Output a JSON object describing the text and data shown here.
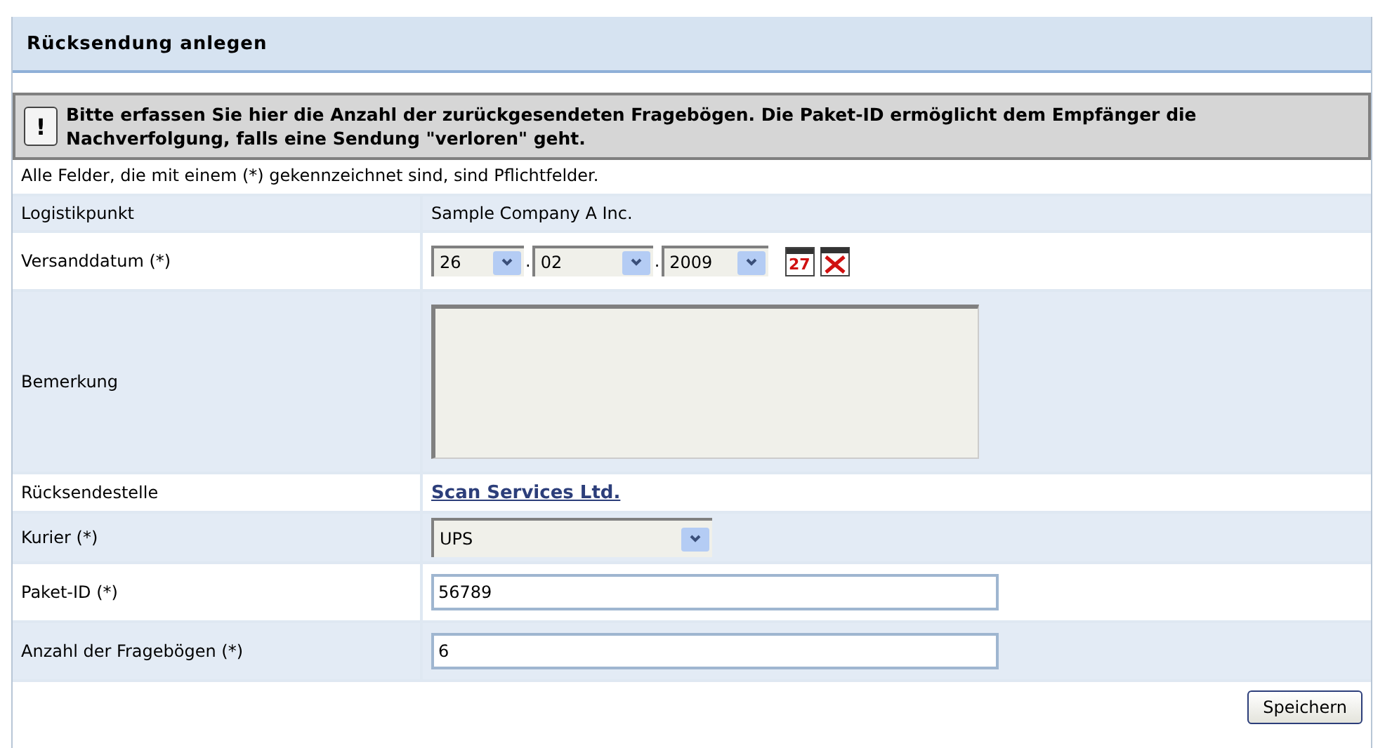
{
  "panel": {
    "title": "Rücksendung anlegen"
  },
  "notice": {
    "icon": "!",
    "text": "Bitte erfassen Sie hier die Anzahl der zurückgesendeten Fragebögen. Die Paket-ID ermöglicht dem Empfänger die Nachverfolgung, falls eine Sendung \"verloren\" geht."
  },
  "hint": "Alle Felder, die mit einem (*) gekennzeichnet sind, sind Pflichtfelder.",
  "rows": [
    {
      "kind": "text",
      "label": "Logistikpunkt",
      "value": "Sample Company A Inc."
    },
    {
      "kind": "date",
      "label": "Versanddatum (*)",
      "day": "26",
      "month": "02",
      "year": "2009",
      "separator": ".",
      "calendar": "27"
    },
    {
      "kind": "textarea",
      "label": "Bemerkung"
    },
    {
      "kind": "link",
      "label": "Rücksendestelle",
      "value": "Scan Services Ltd."
    },
    {
      "kind": "select",
      "label": "Kurier (*)",
      "value": "UPS"
    },
    {
      "kind": "input",
      "label": "Paket-ID (*)",
      "value": "56789"
    },
    {
      "kind": "input",
      "label": "Anzahl der Fragebögen (*)",
      "value": "6"
    }
  ],
  "save_button": "Speichern"
}
